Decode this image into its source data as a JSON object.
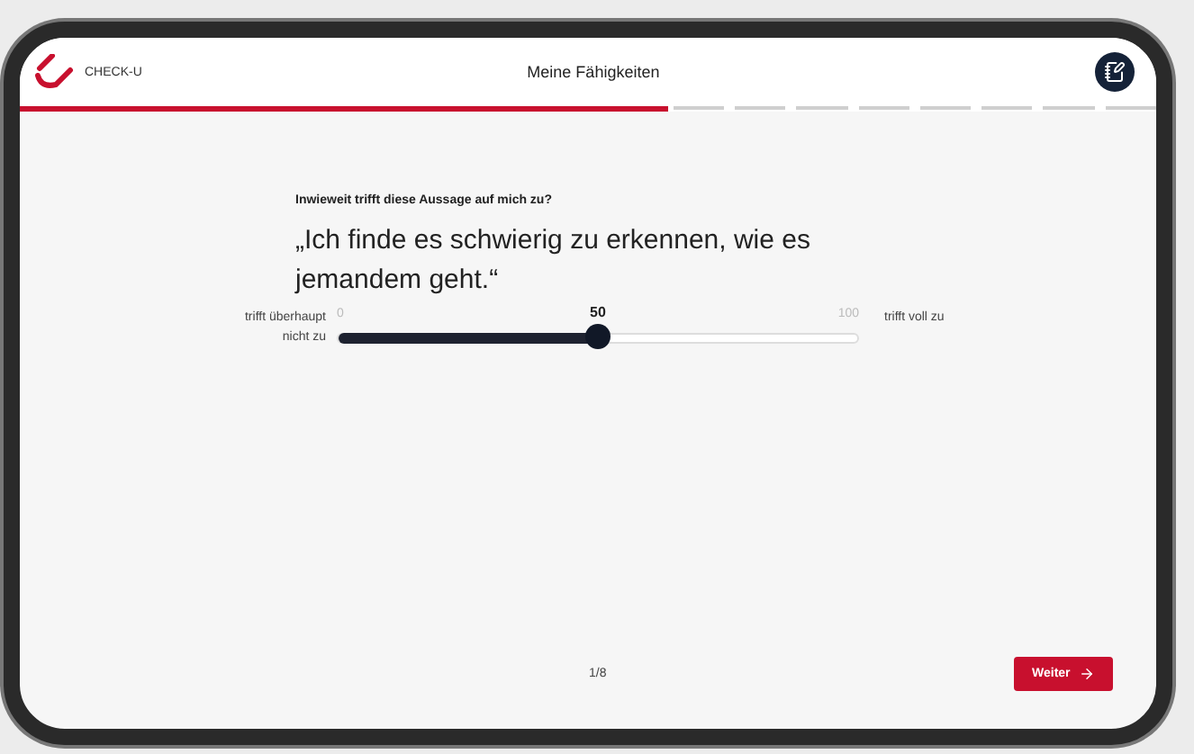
{
  "header": {
    "brand": "CHECK-U",
    "title": "Meine Fähigkeiten"
  },
  "progress": {
    "level": 0.57
  },
  "question": {
    "prompt": "Inwieweit trifft diese Aussage auf mich zu?",
    "statement": "„Ich finde es schwierig zu erkennen, wie es jemandem geht.“"
  },
  "slider": {
    "left_label": "trifft überhaupt nicht zu",
    "right_label": "trifft voll zu",
    "min": "0",
    "max": "100",
    "value": "50",
    "level": 0.5
  },
  "footer": {
    "counter": "1/8",
    "next_button": "Weiter"
  }
}
